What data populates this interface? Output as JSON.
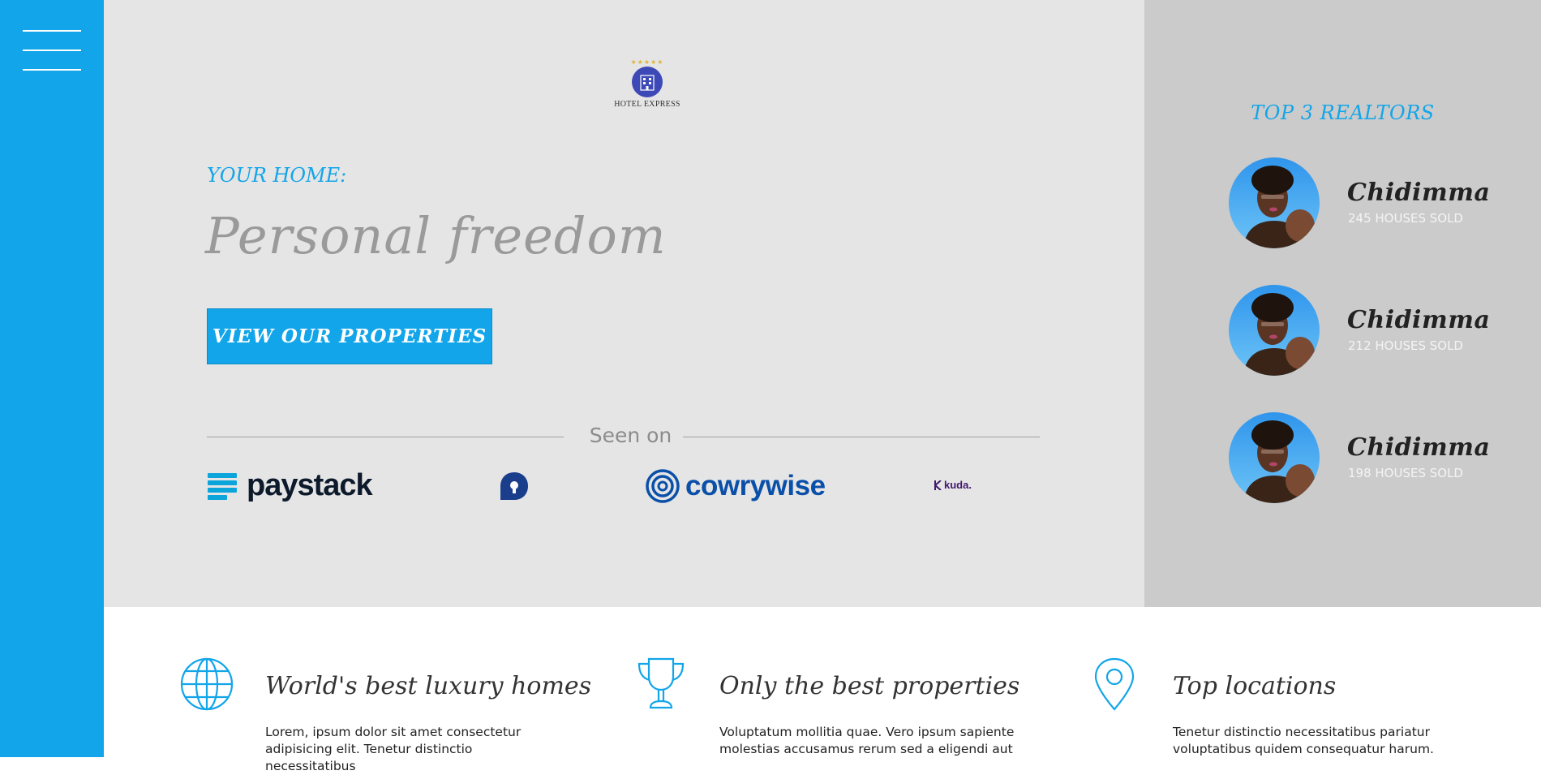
{
  "brand": {
    "logo_text": "HOTEL EXPRESS",
    "accent": "#12a5e9"
  },
  "hero": {
    "kicker": "YOUR HOME:",
    "headline": "Personal freedom",
    "cta_label": "VIEW OUR PROPERTIES",
    "seen_on_label": "Seen on",
    "partners": [
      "paystack",
      "piggyvest",
      "cowrywise",
      "kuda."
    ]
  },
  "realtors": {
    "title": "TOP 3 REALTORS",
    "items": [
      {
        "name": "Chidimma",
        "sold": "245 HOUSES SOLD"
      },
      {
        "name": "Chidimma",
        "sold": "212 HOUSES SOLD"
      },
      {
        "name": "Chidimma",
        "sold": "198 HOUSES SOLD"
      }
    ]
  },
  "features": [
    {
      "icon": "globe-icon",
      "title": "World's best luxury homes",
      "text": "Lorem, ipsum dolor sit amet consectetur adipisicing elit. Tenetur distinctio necessitatibus"
    },
    {
      "icon": "trophy-icon",
      "title": "Only the best properties",
      "text": "Voluptatum mollitia quae. Vero ipsum sapiente molestias accusamus rerum sed a eligendi aut"
    },
    {
      "icon": "map-pin-icon",
      "title": "Top locations",
      "text": "Tenetur distinctio necessitatibus pariatur voluptatibus quidem consequatur harum."
    }
  ]
}
